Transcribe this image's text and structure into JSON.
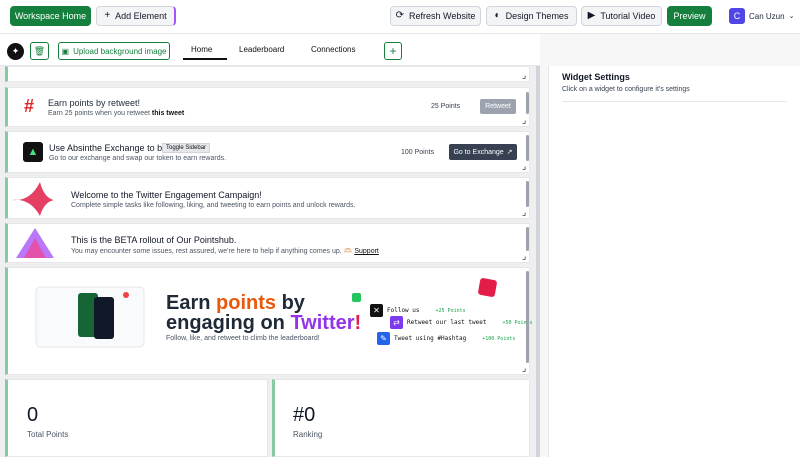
{
  "topbar": {
    "workspace_home": "Workspace Home",
    "add_element": "Add Element",
    "refresh": "Refresh Website",
    "design_themes": "Design Themes",
    "tutorial": "Tutorial Video",
    "preview": "Preview",
    "user_initial": "C",
    "user_name": "Can Uzun"
  },
  "subbar": {
    "upload_bg": "Upload background image",
    "tabs": [
      "Home",
      "Leaderboard",
      "Connections"
    ]
  },
  "widgets": {
    "retweet": {
      "title": "Earn points by retweet!",
      "sub_prefix": "Earn 25 points when you retweet ",
      "sub_bold": "this tweet",
      "points": "25 Points",
      "button": "Retweet"
    },
    "exchange": {
      "title": "Use Absinthe Exchange to buy",
      "tooltip": "Toggle Sidebar",
      "sub": "Go to our exchange and swap our token to earn rewards.",
      "points": "100 Points",
      "button": "Go to Exchange"
    },
    "welcome": {
      "title": "Welcome to the Twitter Engagement Campaign!",
      "sub": "Complete simple tasks like following, liking, and tweeting to earn points and unlock rewards."
    },
    "beta": {
      "title": "This is the BETA rollout of Our Pointshub.",
      "sub": "You may encounter some issues, rest assured, we're here to help if anything comes up. 🫶🏻 ",
      "link": "Support"
    },
    "banner": {
      "line1_a": "Earn ",
      "line1_b": "points",
      "line1_c": " by",
      "line2_a": "engaging on ",
      "line2_b": "Twitter",
      "line2_c": "!",
      "sub": "Follow, like, and retweet to climb the leaderboard!",
      "tasks": [
        {
          "label": "Follow us",
          "points": "+25 Points"
        },
        {
          "label": "Retweet our last tweet",
          "points": "+50 Points"
        },
        {
          "label": "Tweet using #Hashtag",
          "points": "+100 Points"
        }
      ]
    },
    "stats": {
      "total_value": "0",
      "total_label": "Total Points",
      "rank_value": "#0",
      "rank_label": "Ranking"
    }
  },
  "panel": {
    "title": "Widget Settings",
    "sub": "Click on a widget to configure it's settings"
  },
  "colors": {
    "primary_green": "#15803d",
    "accent_red": "#dc2626"
  }
}
